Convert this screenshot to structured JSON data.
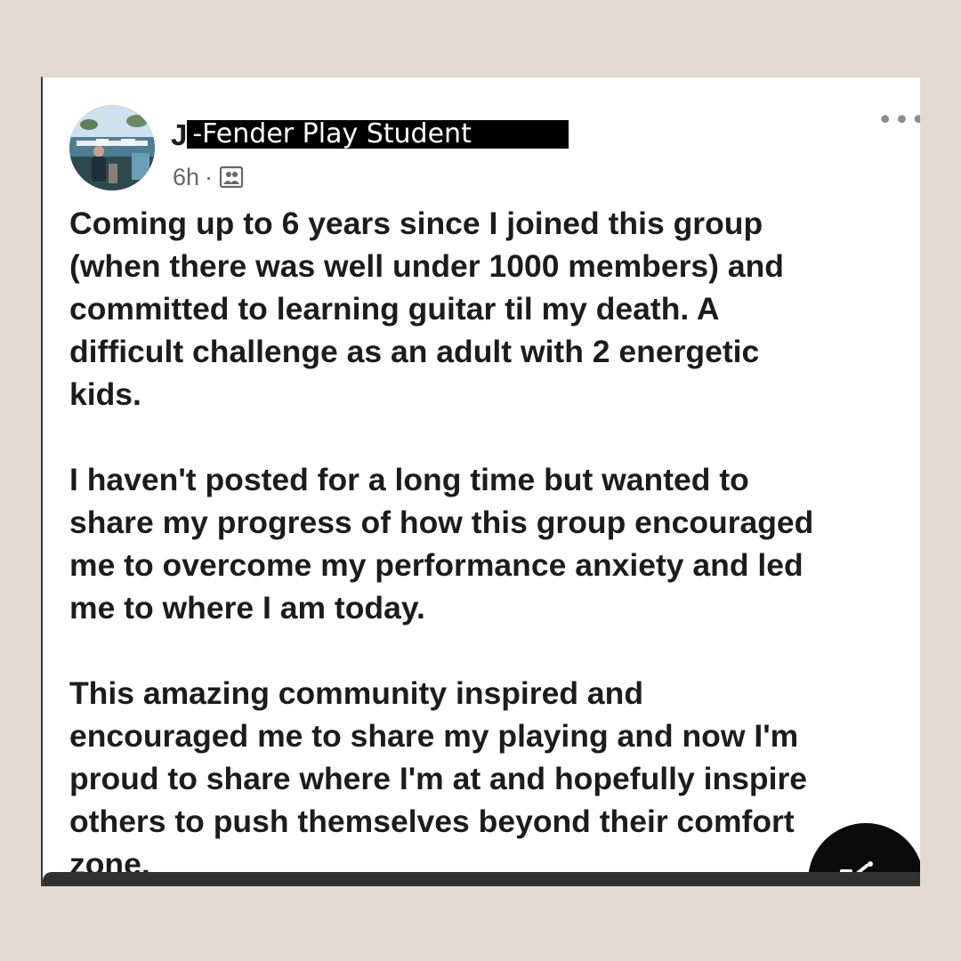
{
  "post": {
    "author_initial": "J",
    "author_label": "-Fender Play Student",
    "time": "6h",
    "separator": "·",
    "audience_icon": "group-icon",
    "more_icon": "more-horizontal-icon",
    "more_label": "•••",
    "paragraphs": [
      "Coming up to 6 years since I joined this group\n(when there was well under 1000 members) and\ncommitted to learning guitar til my death. A\ndifficult challenge as an adult with 2 energetic\nkids.",
      "I haven't posted for a long time but wanted to\nshare my progress of how this group encouraged\nme to overcome my performance anxiety and led\nme to where I am today.",
      "This amazing community inspired and\nencouraged me to share my playing and now I'm\nproud to share where I'm at and hopefully inspire\nothers to push themselves beyond their comfort\nzone."
    ]
  },
  "floating_button": {
    "icon": "compose-icon"
  },
  "colors": {
    "background": "#e3dbd2",
    "card": "#ffffff",
    "text": "#1c1c1c",
    "meta": "#65676b",
    "tag_background": "#000000",
    "bottom_bar": "#2f3133"
  }
}
